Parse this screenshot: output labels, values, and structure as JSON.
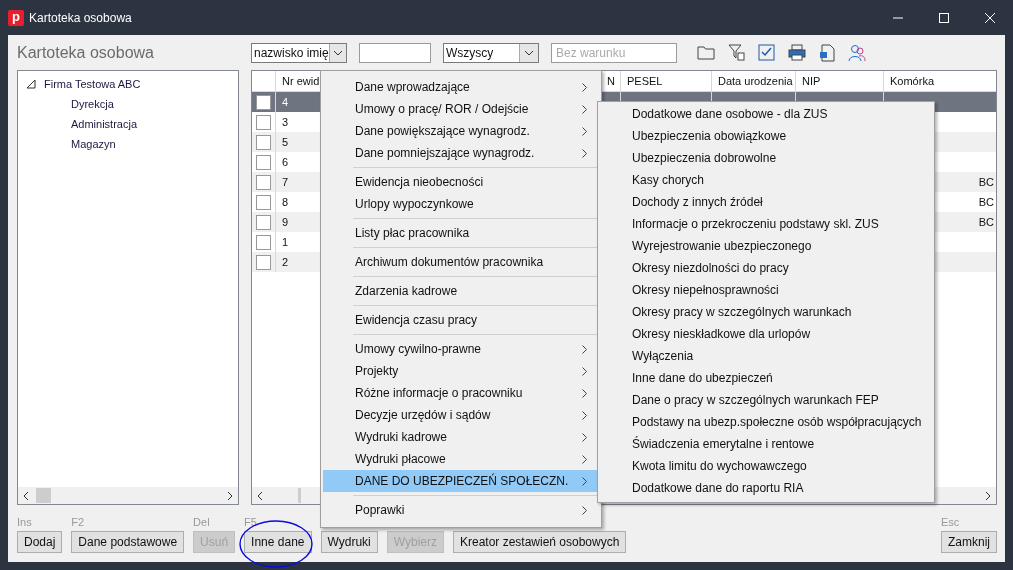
{
  "window": {
    "title": "Kartoteka osobowa",
    "app_icon_letter": "p"
  },
  "heading": "Kartoteka osobowa",
  "toolbar": {
    "sort_select": "nazwisko imię",
    "filter_select": "Wszyscy",
    "condition_field": {
      "placeholder": "Bez warunku"
    }
  },
  "tree": {
    "label": "Firma Testowa ABC",
    "expanded": true,
    "children": [
      {
        "label": "Dyrekcja"
      },
      {
        "label": "Administracja"
      },
      {
        "label": "Magazyn"
      }
    ]
  },
  "table": {
    "columns": [
      "Nr ewid",
      "N",
      "PESEL",
      "Data urodzenia",
      "NIP",
      "Komórka"
    ],
    "rows": [
      {
        "nr": "4",
        "selected": true,
        "checked": false
      },
      {
        "nr": "3",
        "selected": false,
        "checked": false
      },
      {
        "nr": "5",
        "selected": false,
        "checked": false
      },
      {
        "nr": "6",
        "selected": false,
        "checked": false
      },
      {
        "nr": "7",
        "komorka": "BC",
        "selected": false,
        "checked": false
      },
      {
        "nr": "8",
        "komorka": "BC",
        "selected": false,
        "checked": false
      },
      {
        "nr": "9",
        "komorka": "BC",
        "selected": false,
        "checked": false
      },
      {
        "nr": "1",
        "selected": false,
        "checked": false
      },
      {
        "nr": "2",
        "selected": false,
        "checked": false
      }
    ]
  },
  "context_menu": {
    "groups": [
      {
        "items": [
          {
            "label": "Dane wprowadzające",
            "submenu": true,
            "selected": false
          },
          {
            "label": "Umowy o pracę/ ROR / Odejście",
            "submenu": true,
            "selected": false
          },
          {
            "label": "Dane powiększające wynagrodz.",
            "submenu": true,
            "selected": false
          },
          {
            "label": "Dane pomniejszające wynagrodz.",
            "submenu": true,
            "selected": false
          }
        ]
      },
      {
        "items": [
          {
            "label": "Ewidencja nieobecności",
            "submenu": false,
            "selected": false
          },
          {
            "label": "Urlopy wypoczynkowe",
            "submenu": false,
            "selected": false
          }
        ]
      },
      {
        "items": [
          {
            "label": "Listy płac pracownika",
            "submenu": false,
            "selected": false
          }
        ]
      },
      {
        "items": [
          {
            "label": "Archiwum dokumentów pracownika",
            "submenu": false,
            "selected": false
          }
        ]
      },
      {
        "items": [
          {
            "label": "Zdarzenia kadrowe",
            "submenu": false,
            "selected": false
          }
        ]
      },
      {
        "items": [
          {
            "label": "Ewidencja czasu pracy",
            "submenu": false,
            "selected": false
          }
        ]
      },
      {
        "items": [
          {
            "label": "Umowy cywilno-prawne",
            "submenu": true,
            "selected": false
          },
          {
            "label": "Projekty",
            "submenu": true,
            "selected": false
          },
          {
            "label": "Różne informacje o pracowniku",
            "submenu": true,
            "selected": false
          },
          {
            "label": "Decyzje urzędów i sądów",
            "submenu": true,
            "selected": false
          },
          {
            "label": "Wydruki kadrowe",
            "submenu": true,
            "selected": false
          },
          {
            "label": "Wydruki płacowe",
            "submenu": true,
            "selected": false
          },
          {
            "label": "DANE DO UBEZPIECZEŃ SPOŁECZN.",
            "submenu": true,
            "selected": true
          }
        ]
      },
      {
        "items": [
          {
            "label": "Poprawki",
            "submenu": true,
            "selected": false
          }
        ]
      }
    ]
  },
  "submenu": {
    "items": [
      "Dodatkowe dane osobowe - dla ZUS",
      "Ubezpieczenia obowiązkowe",
      "Ubezpieczenia dobrowolne",
      "Kasy chorych",
      "Dochody z innych źródeł",
      "Informacje o przekroczeniu podstawy skl. ZUS",
      "Wyrejestrowanie ubezpieczonego",
      "Okresy niezdolności do pracy",
      "Okresy niepełnosprawności",
      "Okresy pracy w szczególnych warunkach",
      "Okresy nieskładkowe dla urlopów",
      "Wyłączenia",
      "Inne dane do ubezpieczeń",
      "Dane o pracy w szczególnych warunkach FEP",
      "Podstawy na ubezp.społeczne osób współpracujących",
      "Świadczenia emerytalne i rentowe",
      "Kwota limitu do wychowawczego",
      "Dodatkowe dane do raportu RIA"
    ]
  },
  "buttons": [
    {
      "key": "Ins",
      "label": "Dodaj",
      "disabled": false,
      "highlighted": false
    },
    {
      "key": "F2",
      "label": "Dane podstawowe",
      "disabled": false,
      "highlighted": false
    },
    {
      "key": "Del",
      "label": "Usuń",
      "disabled": true,
      "highlighted": false
    },
    {
      "key": "F5",
      "label": "Inne dane",
      "disabled": false,
      "highlighted": true
    },
    {
      "label": "Wydruki",
      "disabled": false,
      "highlighted": false
    },
    {
      "label": "Wybierz",
      "disabled": true,
      "highlighted": false
    },
    {
      "label": "Kreator zestawień osobowych",
      "disabled": false,
      "highlighted": false
    },
    {
      "key": "Esc",
      "label": "Zamknij",
      "disabled": false,
      "highlighted": false
    }
  ]
}
